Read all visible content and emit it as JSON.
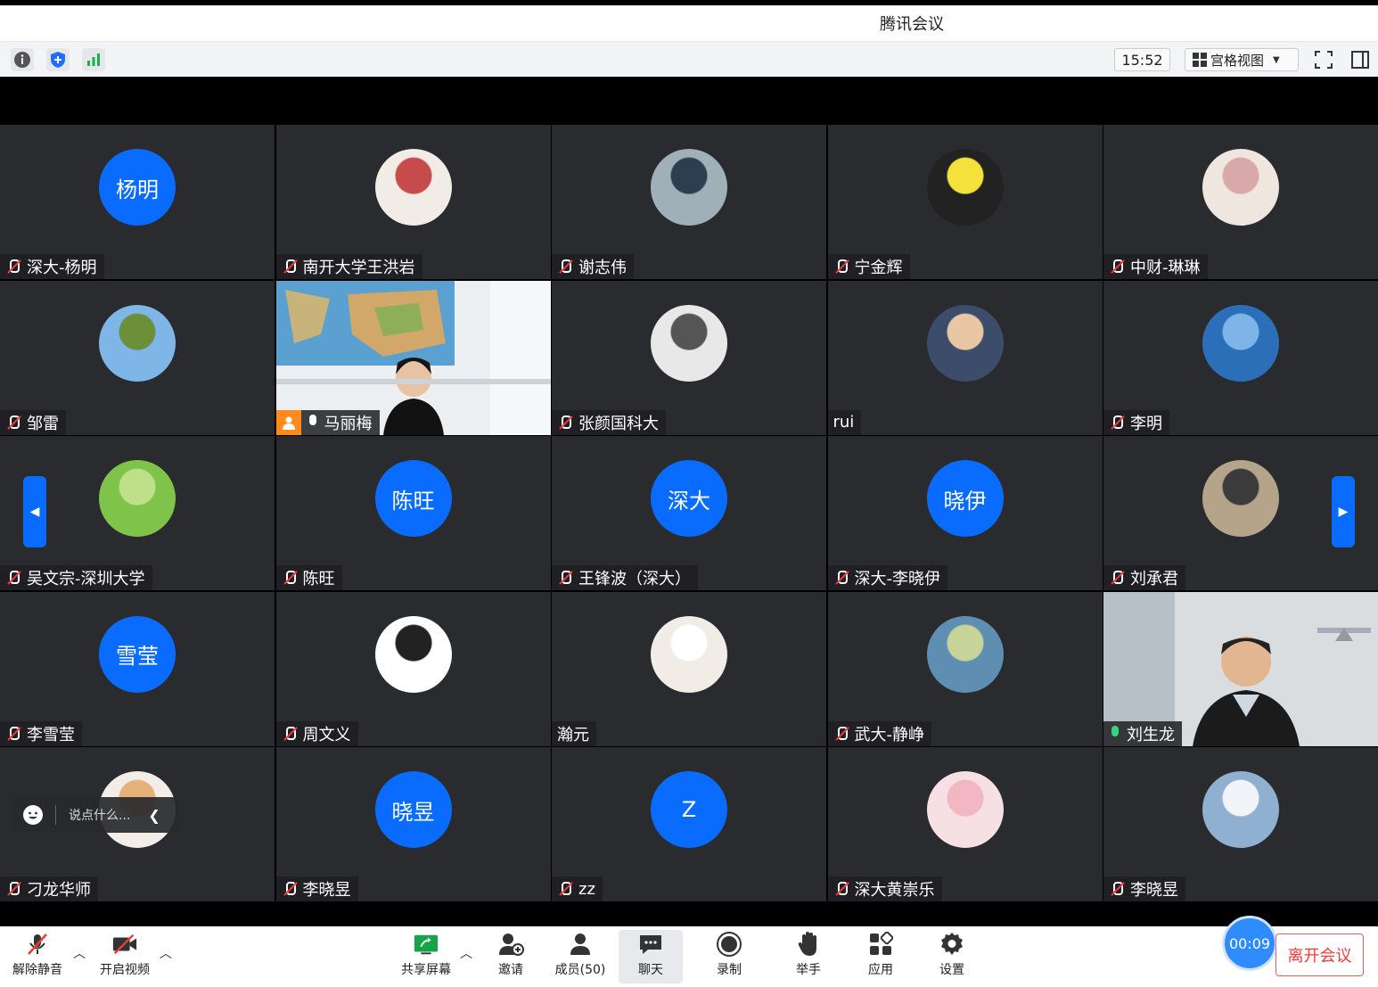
{
  "app": {
    "title": "腾讯会议"
  },
  "toolbar": {
    "time": "15:52",
    "view_label": "宫格视图"
  },
  "participants": [
    {
      "name": "深大-杨明",
      "avatar_text": "杨明",
      "avatar": "blue",
      "mic": "muted"
    },
    {
      "name": "南开大学王洪岩",
      "avatar": "photo",
      "mic": "muted"
    },
    {
      "name": "谢志伟",
      "avatar": "photo",
      "mic": "muted"
    },
    {
      "name": "宁金辉",
      "avatar": "photo",
      "mic": "muted"
    },
    {
      "name": "中财-琳琳",
      "avatar": "photo",
      "mic": "muted"
    },
    {
      "name": "邹雷",
      "avatar": "photo",
      "mic": "muted"
    },
    {
      "name": "马丽梅",
      "avatar": "video",
      "mic": "on",
      "host": true
    },
    {
      "name": "张颜国科大",
      "avatar": "photo",
      "mic": "muted"
    },
    {
      "name": "rui",
      "avatar": "photo",
      "mic": "none"
    },
    {
      "name": "李明",
      "avatar": "photo",
      "mic": "muted"
    },
    {
      "name": "吴文宗-深圳大学",
      "avatar": "photo",
      "mic": "muted"
    },
    {
      "name": "陈旺",
      "avatar_text": "陈旺",
      "avatar": "blue",
      "mic": "muted"
    },
    {
      "name": "王锋波（深大）",
      "avatar_text": "深大",
      "avatar": "blue",
      "mic": "muted"
    },
    {
      "name": "深大-李晓伊",
      "avatar_text": "晓伊",
      "avatar": "blue",
      "mic": "muted"
    },
    {
      "name": "刘承君",
      "avatar": "photo",
      "mic": "muted"
    },
    {
      "name": "李雪莹",
      "avatar_text": "雪莹",
      "avatar": "blue",
      "mic": "muted"
    },
    {
      "name": "周文义",
      "avatar": "photo",
      "mic": "muted"
    },
    {
      "name": "瀚元",
      "avatar": "photo",
      "mic": "none"
    },
    {
      "name": "武大-静峥",
      "avatar": "photo",
      "mic": "muted"
    },
    {
      "name": "刘生龙",
      "avatar": "video",
      "mic": "speaking",
      "active": true
    },
    {
      "name": "刁龙华师",
      "avatar": "photo",
      "mic": "muted"
    },
    {
      "name": "李晓昱",
      "avatar_text": "晓昱",
      "avatar": "blue",
      "mic": "muted"
    },
    {
      "name": "zz",
      "avatar_text": "Z",
      "avatar": "blue",
      "mic": "muted"
    },
    {
      "name": "深大黄崇乐",
      "avatar": "photo",
      "mic": "muted"
    },
    {
      "name": "李晓昱",
      "avatar": "photo",
      "mic": "muted"
    }
  ],
  "chat": {
    "placeholder": "说点什么..."
  },
  "bottom": {
    "unmute": "解除静音",
    "video": "开启视频",
    "share": "共享屏幕",
    "invite": "邀请",
    "members": "成员(50)",
    "chat": "聊天",
    "record": "录制",
    "raise": "举手",
    "apps": "应用",
    "settings": "设置",
    "timer": "00:09",
    "leave": "离开会议"
  },
  "colors": {
    "avatar_blue": "#0a6cff",
    "tile_bg": "#2a2b2e",
    "leave_red": "#f03a3a",
    "active_green": "#1fc26a"
  }
}
